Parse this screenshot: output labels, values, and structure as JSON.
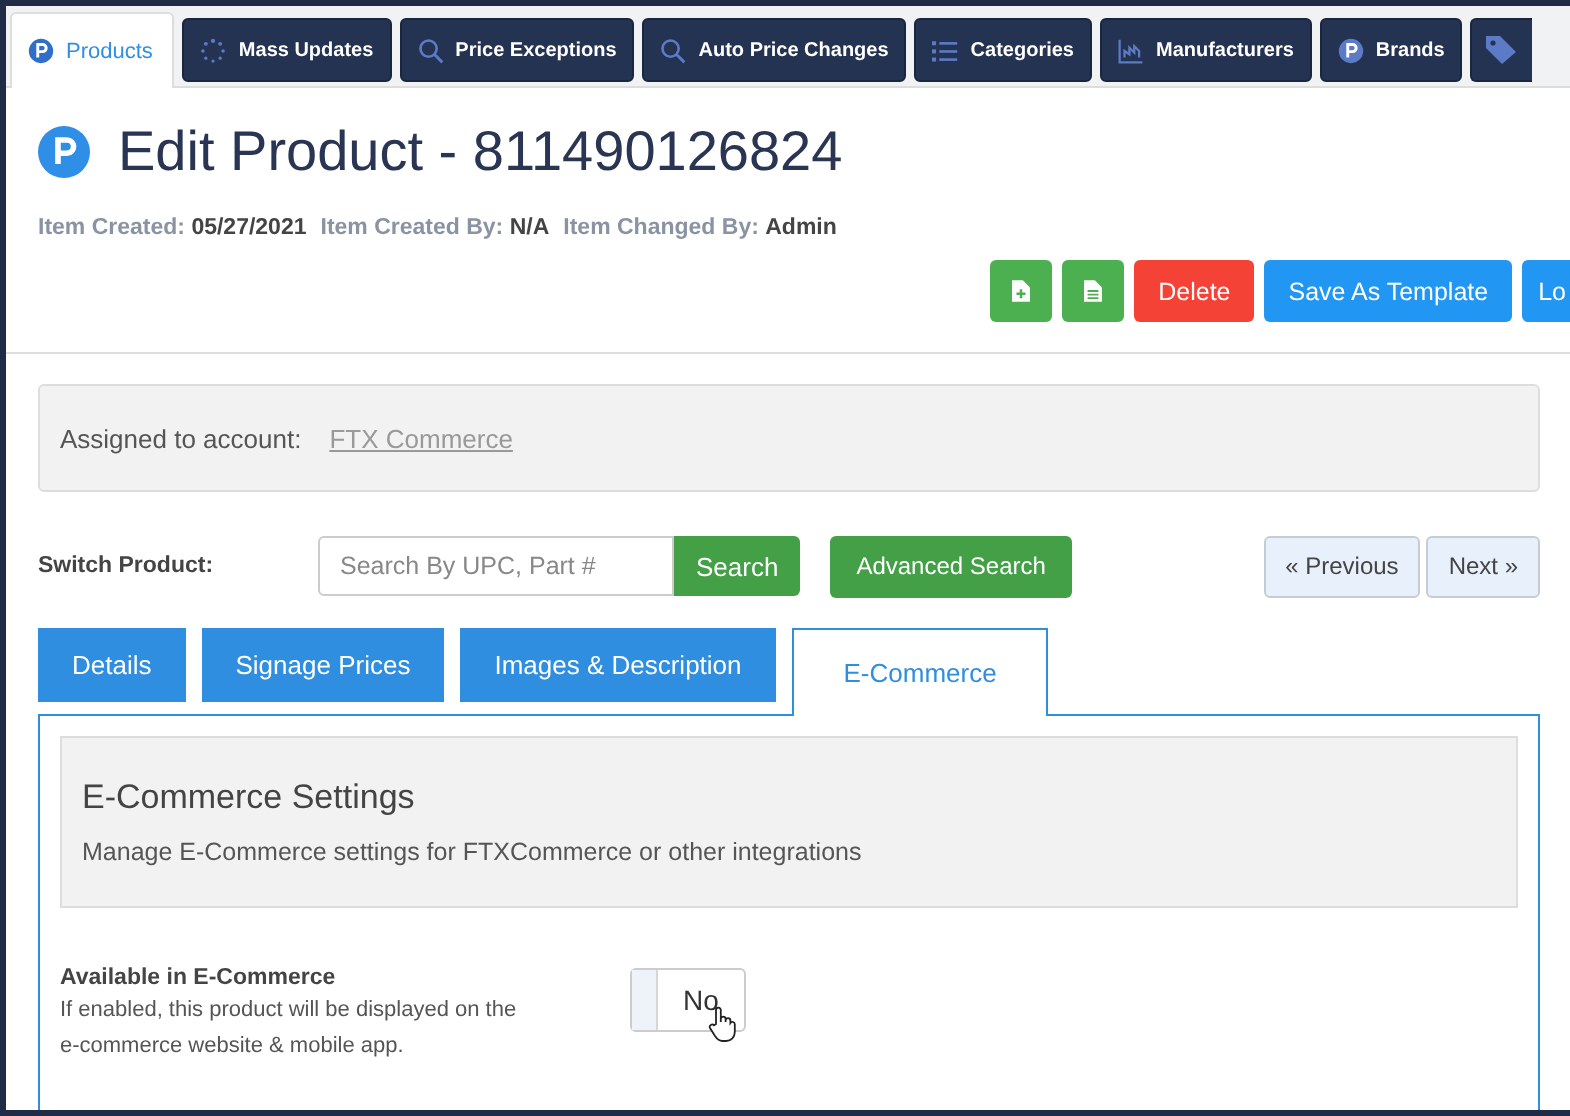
{
  "nav_tabs": [
    {
      "label": "Products",
      "kind": "badge",
      "selected": true
    },
    {
      "label": "Mass Updates",
      "kind": "spinner",
      "selected": false
    },
    {
      "label": "Price Exceptions",
      "kind": "search",
      "selected": false
    },
    {
      "label": "Auto Price Changes",
      "kind": "search",
      "selected": false
    },
    {
      "label": "Categories",
      "kind": "list",
      "selected": false
    },
    {
      "label": "Manufacturers",
      "kind": "chart",
      "selected": false
    },
    {
      "label": "Brands",
      "kind": "badge",
      "selected": false
    },
    {
      "kind": "tag",
      "selected": false
    }
  ],
  "title": "Edit Product - 811490126824",
  "meta": [
    {
      "label": "Item Created:",
      "value": "05/27/2021"
    },
    {
      "label": "Item Created By:",
      "value": "N/A"
    },
    {
      "label": "Item Changed By:",
      "value": "Admin"
    }
  ],
  "actions": [
    {
      "kind": "add"
    },
    {
      "kind": "doc"
    },
    {
      "kind": "danger",
      "label": "Delete"
    },
    {
      "kind": "primary",
      "label": "Save As Template"
    },
    {
      "kind": "cut",
      "label": "Lo"
    }
  ],
  "account": {
    "label": "Assigned to account:",
    "link": "FTX Commerce"
  },
  "switch": {
    "label": "Switch Product:",
    "placeholder": "Search By UPC, Part #",
    "search": "Search",
    "advanced": "Advanced Search",
    "previous": "« Previous",
    "next": "Next »"
  },
  "section_tabs": [
    {
      "label": "Details",
      "selected": false
    },
    {
      "label": "Signage Prices",
      "selected": false
    },
    {
      "label": "Images & Description",
      "selected": false
    },
    {
      "label": "E-Commerce",
      "selected": true
    }
  ],
  "settings": {
    "heading": "E-Commerce Settings",
    "description": "Manage E-Commerce settings for FTXCommerce or other integrations"
  },
  "option": {
    "label": "Available in E-Commerce",
    "help": "If enabled, this product will be displayed on the e-commerce website & mobile app.",
    "on": false,
    "value": "No"
  }
}
